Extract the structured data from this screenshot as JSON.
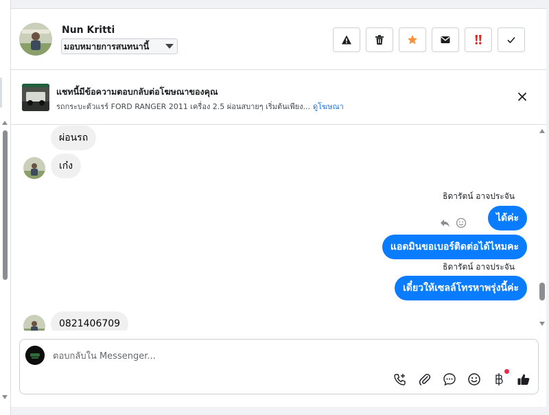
{
  "header": {
    "contact_name": "Nun Kritti",
    "assign_label": "มอบหมายการสนทนานี้",
    "actions": [
      {
        "name": "report-spam",
        "icon": "warning-icon"
      },
      {
        "name": "delete",
        "icon": "trash-icon"
      },
      {
        "name": "star",
        "icon": "star-icon",
        "color": "#f7923b"
      },
      {
        "name": "mark-unread",
        "icon": "envelope-icon"
      },
      {
        "name": "follow-up",
        "icon": "double-exclamation-icon",
        "color": "#e02424"
      },
      {
        "name": "mark-done",
        "icon": "check-icon"
      }
    ]
  },
  "ad_banner": {
    "title": "แชทนี้มีข้อความตอบกลับต่อโฆษณาของคุณ",
    "subtitle": "รถกระบะตัวแรร์ FORD RANGER 2011 เครื่อง 2.5 ผ่อนสบายๆ เริ่มต้นเพียง...",
    "link_label": "ดูโฆษณา"
  },
  "messages": [
    {
      "direction": "in",
      "text": "ผ่อนรถ"
    },
    {
      "direction": "in",
      "text": "เก๋ง"
    },
    {
      "direction": "out",
      "sender": "ธิดารัตน์ อาจประจัน",
      "text": "ได้ค่ะ"
    },
    {
      "direction": "out",
      "text": "แอดมินขอเบอร์ติดต่อได้ไหมคะ"
    },
    {
      "direction": "out",
      "sender": "ธิดารัตน์ อาจประจัน",
      "text": "เดี๋ยวให้เซลล์โทรหาพรุ่งนี้ค่ะ"
    },
    {
      "direction": "in",
      "text": "0821406709"
    }
  ],
  "composer": {
    "placeholder": "ตอบกลับใน Messenger...",
    "tools": [
      "phone-plus-icon",
      "paperclip-icon",
      "chat-bubble-icon",
      "smiley-icon",
      "baht-icon",
      "thumbs-up-icon"
    ]
  },
  "colors": {
    "accent": "#0a7cff",
    "link": "#1b74e4",
    "notification": "#f02849"
  }
}
